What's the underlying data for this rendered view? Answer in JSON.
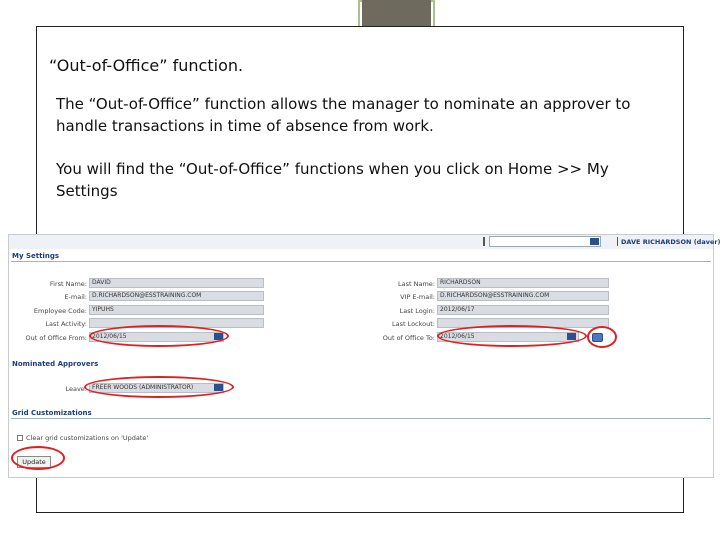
{
  "slide": {
    "title": "“Out-of-Office” function.",
    "paragraph1": "The “Out-of-Office” function allows the manager to nominate an approver to handle transactions in time of absence from work.",
    "paragraph2": "You will find the “Out-of-Office” functions when you click on Home >> My Settings"
  },
  "app": {
    "user_display": "DAVE RICHARDSON (daver)",
    "top_select_value": "",
    "sections": {
      "my_settings": "My Settings",
      "nominated_approvers": "Nominated Approvers",
      "grid_customizations": "Grid Customizations"
    },
    "left_fields": [
      {
        "label": "First Name:",
        "value": "DAVID"
      },
      {
        "label": "E-mail:",
        "value": "D.RICHARDSON@ESSTRAINING.COM"
      },
      {
        "label": "Employee Code:",
        "value": "YIPUHS"
      },
      {
        "label": "Last Activity:",
        "value": ""
      }
    ],
    "right_fields": [
      {
        "label": "Last Name:",
        "value": "RICHARDSON"
      },
      {
        "label": "VIP E-mail:",
        "value": "D.RICHARDSON@ESSTRAINING.COM"
      },
      {
        "label": "Last Login:",
        "value": "2012/06/17"
      },
      {
        "label": "Last Lockout:",
        "value": ""
      }
    ],
    "out_of_office_from": {
      "label": "Out of Office From:",
      "value": "2012/06/15"
    },
    "out_of_office_to": {
      "label": "Out of Office To:",
      "value": "2012/06/15"
    },
    "delegate": {
      "label": "Leave:",
      "value": "FREER WOODS (ADMINISTRATOR)"
    },
    "checkbox_label": "Clear grid customizations on 'Update'",
    "update_label": "Update",
    "colors": {
      "highlight": "#e02020",
      "section": "#1d3d7a",
      "field": "#d9dde3"
    }
  }
}
